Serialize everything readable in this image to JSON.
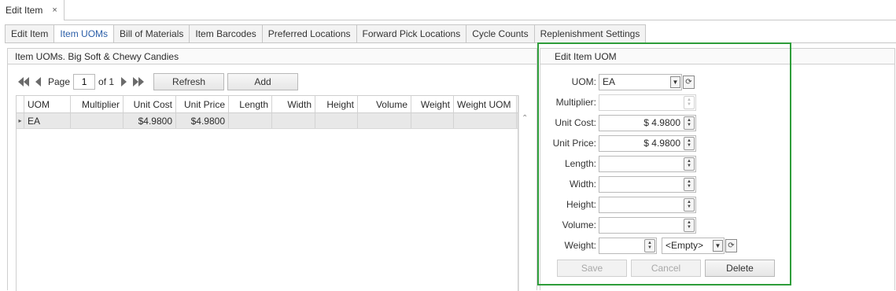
{
  "document_tab": {
    "title": "Edit Item",
    "close_glyph": "×"
  },
  "tabs": [
    {
      "label": "Edit Item",
      "active": false
    },
    {
      "label": "Item UOMs",
      "active": true
    },
    {
      "label": "Bill of Materials",
      "active": false
    },
    {
      "label": "Item Barcodes",
      "active": false
    },
    {
      "label": "Preferred Locations",
      "active": false
    },
    {
      "label": "Forward Pick Locations",
      "active": false
    },
    {
      "label": "Cycle Counts",
      "active": false
    },
    {
      "label": "Replenishment Settings",
      "active": false
    }
  ],
  "left_panel": {
    "title": "Item UOMs. Big Soft & Chewy Candies",
    "pager": {
      "page_label": "Page",
      "page_value": "1",
      "of_label": "of 1",
      "refresh_label": "Refresh",
      "add_label": "Add"
    },
    "grid": {
      "columns": [
        "UOM",
        "Multiplier",
        "Unit Cost",
        "Unit Price",
        "Length",
        "Width",
        "Height",
        "Volume",
        "Weight",
        "Weight UOM"
      ],
      "rows": [
        {
          "uom": "EA",
          "multiplier": "",
          "unit_cost": "$4.9800",
          "unit_price": "$4.9800",
          "length": "",
          "width": "",
          "height": "",
          "volume": "",
          "weight": "",
          "weight_uom": ""
        }
      ]
    }
  },
  "right_panel": {
    "title": "Edit Item UOM",
    "fields": {
      "uom": {
        "label": "UOM:",
        "value": "EA"
      },
      "multiplier": {
        "label": "Multiplier:",
        "value": ""
      },
      "unit_cost": {
        "label": "Unit Cost:",
        "value": "$ 4.9800"
      },
      "unit_price": {
        "label": "Unit Price:",
        "value": "$ 4.9800"
      },
      "length": {
        "label": "Length:",
        "value": ""
      },
      "width": {
        "label": "Width:",
        "value": ""
      },
      "height": {
        "label": "Height:",
        "value": ""
      },
      "volume": {
        "label": "Volume:",
        "value": ""
      },
      "weight": {
        "label": "Weight:",
        "value": "",
        "uom_value": "<Empty>"
      }
    },
    "buttons": {
      "save": "Save",
      "cancel": "Cancel",
      "delete": "Delete"
    }
  },
  "colors": {
    "accent_tab_text": "#2a5ea8",
    "highlight_border": "#2e9d3a",
    "selected_row": "#e8e8e8"
  }
}
